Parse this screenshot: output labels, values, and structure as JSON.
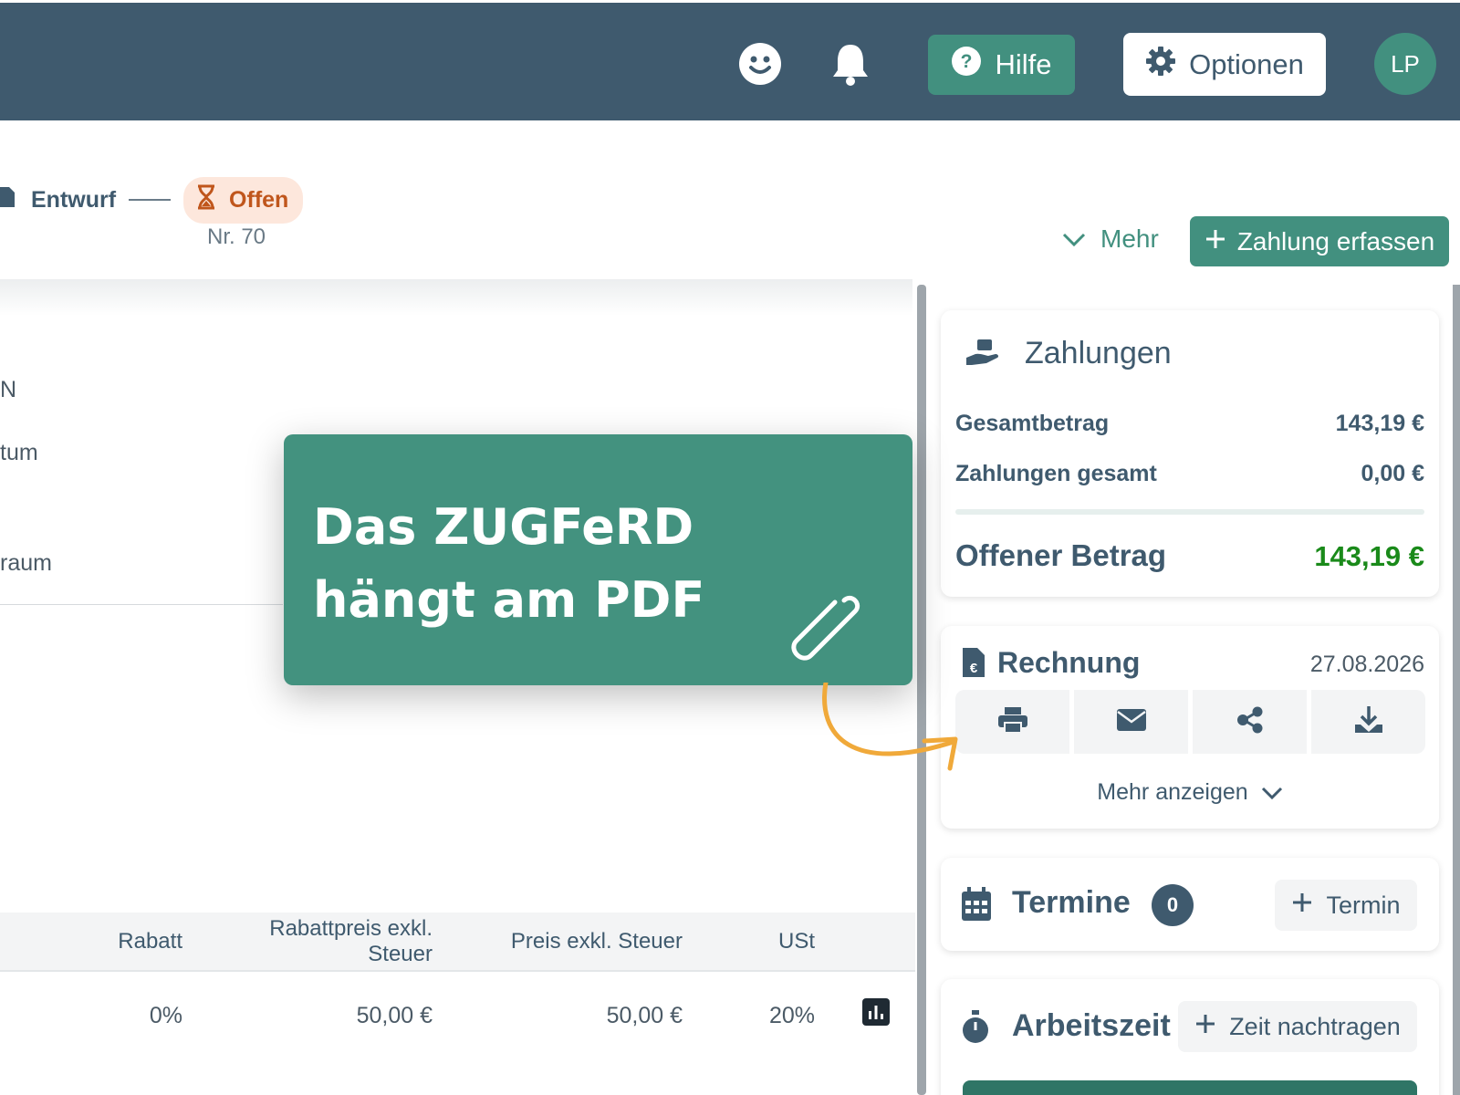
{
  "header": {
    "help_label": "Hilfe",
    "options_label": "Optionen",
    "avatar_initials": "LP"
  },
  "status": {
    "draft_label": "Entwurf",
    "open_label": "Offen",
    "number": "Nr. 70",
    "more_label": "Mehr",
    "record_payment_label": "Zahlung erfassen"
  },
  "fields": {
    "label_1": "N",
    "label_2": "tum",
    "label_3": "raum"
  },
  "table": {
    "headers": {
      "rabatt": "Rabatt",
      "rabattpreis_l1": "Rabattpreis exkl.",
      "rabattpreis_l2": "Steuer",
      "preis": "Preis exkl. Steuer",
      "ust": "USt"
    },
    "row": {
      "rabatt": "0%",
      "rabattpreis": "50,00 €",
      "preis": "50,00 €",
      "ust": "20%"
    }
  },
  "payments": {
    "title": "Zahlungen",
    "total_label": "Gesamtbetrag",
    "total_value": "143,19 €",
    "paid_label": "Zahlungen gesamt",
    "paid_value": "0,00 €",
    "open_label": "Offener Betrag",
    "open_value": "143,19 €",
    "open_color": "#1a8a1a"
  },
  "invoice": {
    "title": "Rechnung",
    "date": "27.08.2026",
    "show_more_label": "Mehr anzeigen"
  },
  "appointments": {
    "title": "Termine",
    "count": "0",
    "add_label": "Termin"
  },
  "worktime": {
    "title": "Arbeitszeit",
    "add_label": "Zeit nachtragen"
  },
  "callout": {
    "text": "Das ZUGFeRD hängt am PDF"
  }
}
